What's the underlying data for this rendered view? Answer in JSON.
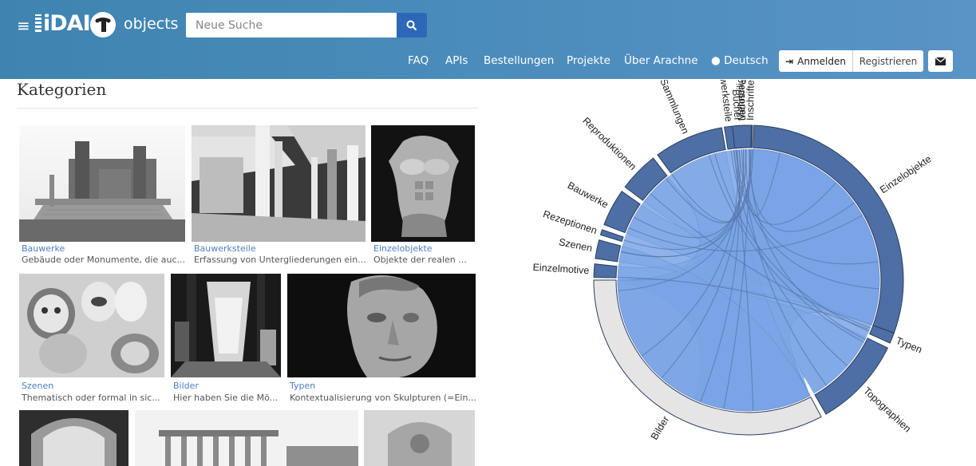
{
  "header": {
    "logo_brand": "iDAI",
    "logo_product": "objects",
    "search_placeholder": "Neue Suche",
    "nav": [
      "FAQ",
      "APIs",
      "Bestellungen",
      "Projekte",
      "Über Arachne",
      "Deutsch"
    ],
    "login_label": "Anmelden",
    "register_label": "Registrieren"
  },
  "page": {
    "heading": "Kategorien"
  },
  "categories": [
    {
      "title": "Bauwerke",
      "desc": "Gebäude oder Monumente, die auc..."
    },
    {
      "title": "Bauwerksteile",
      "desc": "Erfassung von Untergliederungen ein..."
    },
    {
      "title": "Einzelobjekte",
      "desc": "Objekte der realen ..."
    },
    {
      "title": "Szenen",
      "desc": "Thematisch oder formal in sic..."
    },
    {
      "title": "Bilder",
      "desc": "Hier haben Sie die Mö..."
    },
    {
      "title": "Typen",
      "desc": "Kontextualisierung von Skulpturen (=Ein..."
    }
  ],
  "chord": {
    "segments": [
      "Einzelobjekte",
      "Typen",
      "Topographien",
      "Bilder",
      "Einzelmotive",
      "Szenen",
      "Rezeptionen",
      "Bauwerke",
      "Reproduktionen",
      "Sammlungen",
      "Bauwerksteile",
      "Bücher",
      "Personen",
      "Inschriften",
      "Mehrteilige Denkm"
    ]
  },
  "colors": {
    "header_start": "#3f84b0",
    "header_end": "#5a93c6",
    "search_button": "#2d68b8",
    "arc_dark": "#4d6fa5",
    "ribbon": "#7aa4e6",
    "arc_light": "#e5e5e5",
    "link": "#4a7fc0"
  }
}
